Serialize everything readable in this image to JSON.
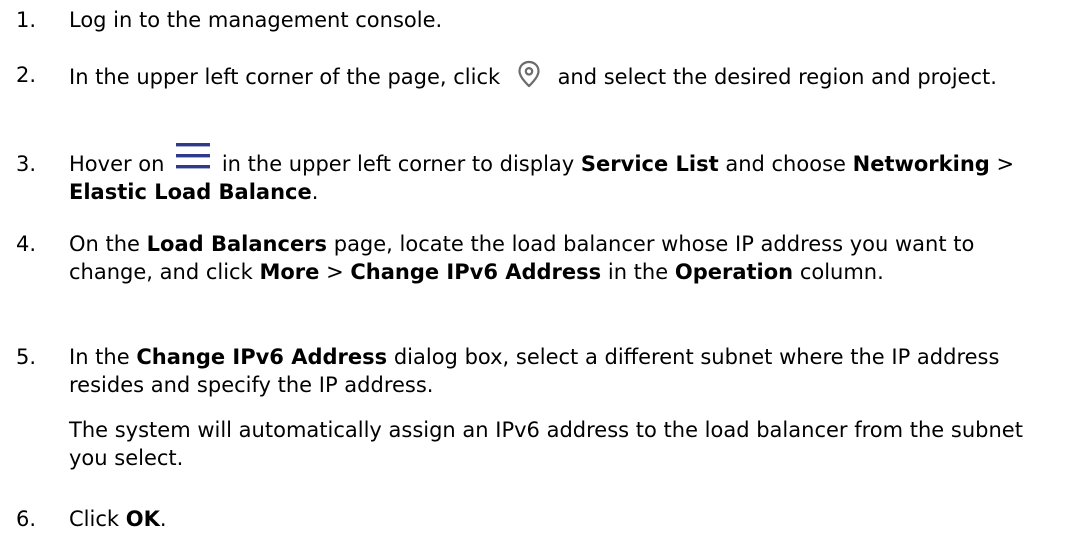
{
  "steps": [
    {
      "number": "1.",
      "parts": [
        "Log in to the management console."
      ]
    },
    {
      "number": "2.",
      "parts": [
        "In the upper left corner of the page, click",
        "and select the desired region and project."
      ],
      "icon": "location-pin-icon"
    },
    {
      "number": "3.",
      "parts": [
        "Hover on",
        "in the upper left corner to display",
        "Service List",
        "and choose",
        "Networking",
        ">",
        "Elastic Load Balance",
        "."
      ],
      "icon": "hamburger-menu-icon"
    },
    {
      "number": "4.",
      "parts": [
        "On the",
        "Load Balancers",
        "page, locate the load balancer whose IP address you want to change, and click",
        "More",
        ">",
        "Change IPv6 Address",
        "in the",
        "Operation",
        "column."
      ]
    },
    {
      "number": "5.",
      "parts": [
        "In the",
        "Change IPv6 Address",
        "dialog box, select a different subnet where the IP address resides and specify the IP address."
      ],
      "note": "The system will automatically assign an IPv6 address to the load balancer from the subnet you select."
    },
    {
      "number": "6.",
      "parts": [
        "Click",
        "OK",
        "."
      ]
    }
  ],
  "colors": {
    "text": "#000000",
    "icon": "#6b6b6b",
    "menu_icon": "#2f3a8c"
  }
}
